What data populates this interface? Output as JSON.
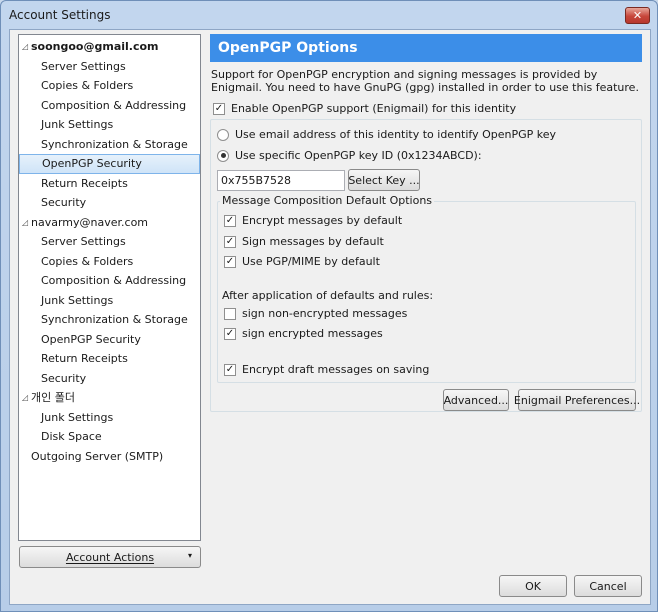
{
  "window": {
    "title": "Account Settings",
    "close_glyph": "✕"
  },
  "tree": {
    "accounts": [
      {
        "name": "soongoo@gmail.com",
        "items": [
          "Server Settings",
          "Copies & Folders",
          "Composition & Addressing",
          "Junk Settings",
          "Synchronization & Storage",
          "OpenPGP Security",
          "Return Receipts",
          "Security"
        ]
      },
      {
        "name": "navarmy@naver.com",
        "items": [
          "Server Settings",
          "Copies & Folders",
          "Composition & Addressing",
          "Junk Settings",
          "Synchronization & Storage",
          "OpenPGP Security",
          "Return Receipts",
          "Security"
        ]
      },
      {
        "name": "개인 폴더",
        "items": [
          "Junk Settings",
          "Disk Space"
        ]
      }
    ],
    "outgoing": "Outgoing Server (SMTP)",
    "selected": "soongoo@gmail.com / OpenPGP Security"
  },
  "account_actions": {
    "label": "Account Actions",
    "arrow": "▾"
  },
  "pane": {
    "header": "OpenPGP Options",
    "description": "Support for OpenPGP encryption and signing messages is provided by Enigmail. You need to have GnuPG (gpg) installed in order to use this feature.",
    "enable": {
      "label": "Enable OpenPGP support (Enigmail) for this identity",
      "checked": true
    },
    "radio_email": {
      "label": "Use email address of this identity to identify OpenPGP key",
      "selected": false
    },
    "radio_keyid": {
      "label": "Use specific OpenPGP key ID (0x1234ABCD):",
      "selected": true
    },
    "key_id_value": "0x755B7528",
    "select_key_label": "Select Key ...",
    "composition_legend": "Message Composition Default Options",
    "encrypt_default": {
      "label": "Encrypt messages by default",
      "checked": true
    },
    "sign_default": {
      "label": "Sign messages by default",
      "checked": true
    },
    "pgpmime_default": {
      "label": "Use PGP/MIME by default",
      "checked": true
    },
    "after_rules": "After application of defaults and rules:",
    "sign_nonenc": {
      "label": "sign non-encrypted messages",
      "checked": false
    },
    "sign_enc": {
      "label": "sign encrypted messages",
      "checked": true
    },
    "encrypt_drafts": {
      "label": "Encrypt draft messages on saving",
      "checked": true
    },
    "advanced_label": "Advanced...",
    "enigmail_prefs_label": "Enigmail Preferences..."
  },
  "footer": {
    "ok_label": "OK",
    "cancel_label": "Cancel"
  },
  "check_glyph": "✓"
}
